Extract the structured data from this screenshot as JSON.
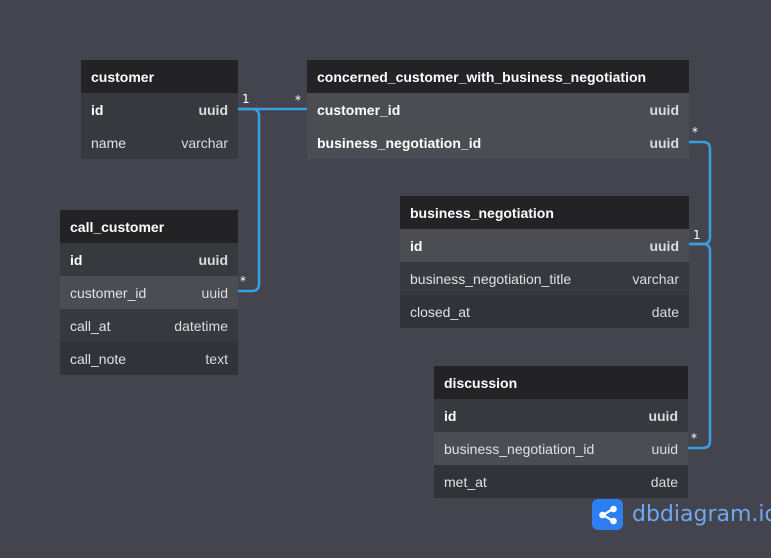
{
  "tables": {
    "customer": {
      "name": "customer",
      "columns": [
        {
          "name": "id",
          "type": "uuid"
        },
        {
          "name": "name",
          "type": "varchar"
        }
      ]
    },
    "concerned": {
      "name": "concerned_customer_with_business_negotiation",
      "columns": [
        {
          "name": "customer_id",
          "type": "uuid"
        },
        {
          "name": "business_negotiation_id",
          "type": "uuid"
        }
      ]
    },
    "call_customer": {
      "name": "call_customer",
      "columns": [
        {
          "name": "id",
          "type": "uuid"
        },
        {
          "name": "customer_id",
          "type": "uuid"
        },
        {
          "name": "call_at",
          "type": "datetime"
        },
        {
          "name": "call_note",
          "type": "text"
        }
      ]
    },
    "business_negotiation": {
      "name": "business_negotiation",
      "columns": [
        {
          "name": "id",
          "type": "uuid"
        },
        {
          "name": "business_negotiation_title",
          "type": "varchar"
        },
        {
          "name": "closed_at",
          "type": "date"
        }
      ]
    },
    "discussion": {
      "name": "discussion",
      "columns": [
        {
          "name": "id",
          "type": "uuid"
        },
        {
          "name": "business_negotiation_id",
          "type": "uuid"
        },
        {
          "name": "met_at",
          "type": "date"
        }
      ]
    }
  },
  "relations": {
    "one": "1",
    "many": "*"
  },
  "brand": {
    "name": "dbdiagram.io",
    "icon": "share-network-icon"
  },
  "colors": {
    "background": "#43444e",
    "header": "#232325",
    "relation_line": "#3a9ee0",
    "brand": "#2d7ff1"
  }
}
